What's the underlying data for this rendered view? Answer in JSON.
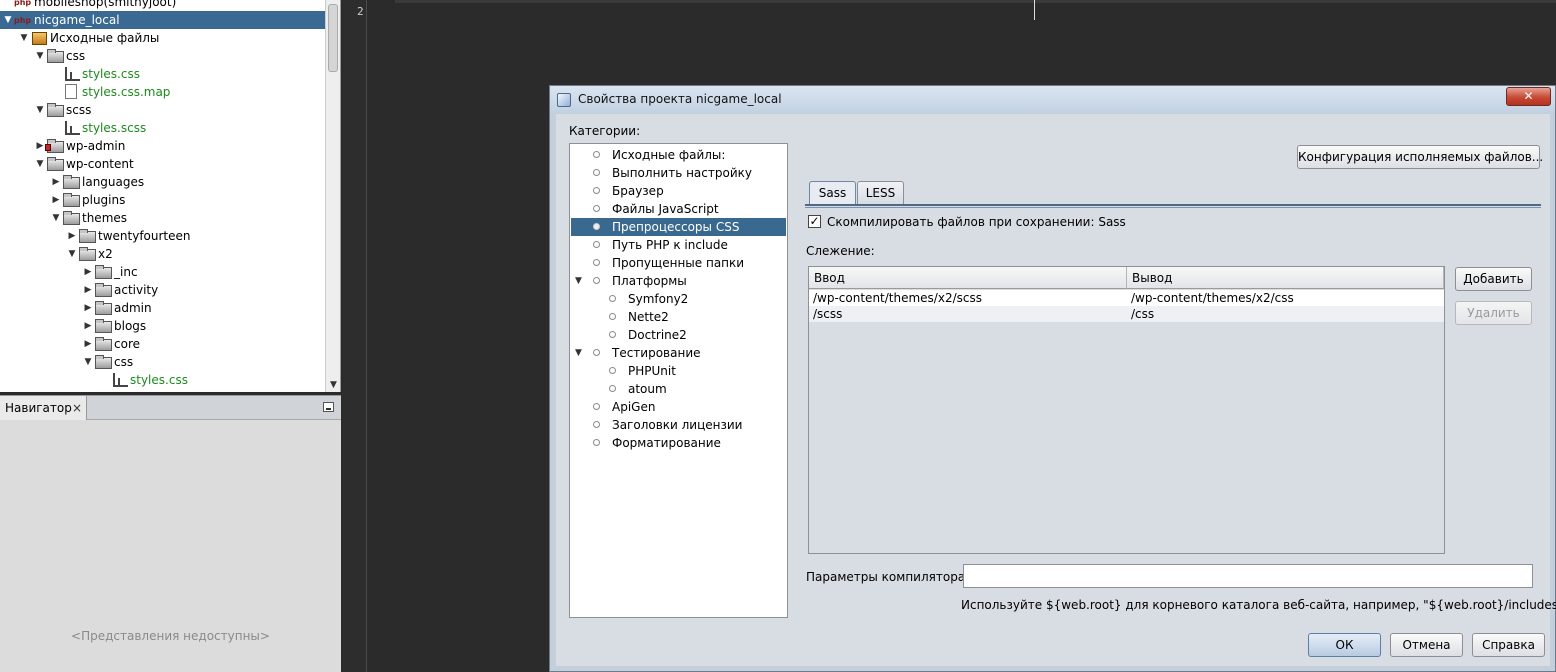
{
  "project_tree": {
    "items": [
      {
        "label": "mobileshop(smithyjoot)",
        "depth": 0,
        "toggle": "",
        "icon": "php-project",
        "green": false
      },
      {
        "label": "nicgame_local",
        "depth": 0,
        "toggle": "▼",
        "icon": "php-project",
        "green": false,
        "selected": true
      },
      {
        "label": "Исходные файлы",
        "depth": 1,
        "toggle": "▼",
        "icon": "source-package",
        "green": false
      },
      {
        "label": "css",
        "depth": 2,
        "toggle": "▼",
        "icon": "folder",
        "green": false
      },
      {
        "label": "styles.css",
        "depth": 3,
        "toggle": "",
        "icon": "css-file",
        "green": true
      },
      {
        "label": "styles.css.map",
        "depth": 3,
        "toggle": "",
        "icon": "document",
        "green": true
      },
      {
        "label": "scss",
        "depth": 2,
        "toggle": "▼",
        "icon": "folder",
        "green": false
      },
      {
        "label": "styles.scss",
        "depth": 3,
        "toggle": "",
        "icon": "css-file",
        "green": true
      },
      {
        "label": "wp-admin",
        "depth": 2,
        "toggle": "▶",
        "icon": "folder-lock",
        "green": false
      },
      {
        "label": "wp-content",
        "depth": 2,
        "toggle": "▼",
        "icon": "folder",
        "green": false
      },
      {
        "label": "languages",
        "depth": 3,
        "toggle": "▶",
        "icon": "folder",
        "green": false
      },
      {
        "label": "plugins",
        "depth": 3,
        "toggle": "▶",
        "icon": "folder",
        "green": false
      },
      {
        "label": "themes",
        "depth": 3,
        "toggle": "▼",
        "icon": "folder",
        "green": false
      },
      {
        "label": "twentyfourteen",
        "depth": 4,
        "toggle": "▶",
        "icon": "folder",
        "green": false
      },
      {
        "label": "x2",
        "depth": 4,
        "toggle": "▼",
        "icon": "folder",
        "green": false
      },
      {
        "label": "_inc",
        "depth": 5,
        "toggle": "▶",
        "icon": "folder",
        "green": false
      },
      {
        "label": "activity",
        "depth": 5,
        "toggle": "▶",
        "icon": "folder",
        "green": false
      },
      {
        "label": "admin",
        "depth": 5,
        "toggle": "▶",
        "icon": "folder",
        "green": false
      },
      {
        "label": "blogs",
        "depth": 5,
        "toggle": "▶",
        "icon": "folder",
        "green": false
      },
      {
        "label": "core",
        "depth": 5,
        "toggle": "▶",
        "icon": "folder",
        "green": false
      },
      {
        "label": "css",
        "depth": 5,
        "toggle": "▼",
        "icon": "folder",
        "green": false
      },
      {
        "label": "styles.css",
        "depth": 6,
        "toggle": "",
        "icon": "css-file",
        "green": true
      }
    ]
  },
  "navigator": {
    "tab_label": "Навигатор",
    "close_glyph": "×",
    "empty_text": "<Представления недоступны>"
  },
  "editor": {
    "line_number": "2"
  },
  "dialog": {
    "title": "Свойства проекта nicgame_local",
    "close_glyph": "✕",
    "categories_label": "Категории:",
    "categories": [
      {
        "label": "Исходные файлы:",
        "level": 0,
        "expander": ""
      },
      {
        "label": "Выполнить настройку",
        "level": 0,
        "expander": ""
      },
      {
        "label": "Браузер",
        "level": 0,
        "expander": ""
      },
      {
        "label": "Файлы JavaScript",
        "level": 0,
        "expander": ""
      },
      {
        "label": "Препроцессоры CSS",
        "level": 0,
        "expander": "",
        "selected": true
      },
      {
        "label": "Путь PHP к include",
        "level": 0,
        "expander": ""
      },
      {
        "label": "Пропущенные папки",
        "level": 0,
        "expander": ""
      },
      {
        "label": "Платформы",
        "level": 0,
        "expander": "▼"
      },
      {
        "label": "Symfony2",
        "level": 1,
        "expander": ""
      },
      {
        "label": "Nette2",
        "level": 1,
        "expander": ""
      },
      {
        "label": "Doctrine2",
        "level": 1,
        "expander": ""
      },
      {
        "label": "Тестирование",
        "level": 0,
        "expander": "▼"
      },
      {
        "label": "PHPUnit",
        "level": 1,
        "expander": ""
      },
      {
        "label": "atoum",
        "level": 1,
        "expander": ""
      },
      {
        "label": "ApiGen",
        "level": 0,
        "expander": ""
      },
      {
        "label": "Заголовки лицензии",
        "level": 0,
        "expander": ""
      },
      {
        "label": "Форматирование",
        "level": 0,
        "expander": ""
      }
    ],
    "configure_executables_button": "Конфигурация исполняемых файлов...",
    "tabs": [
      "Sass",
      "LESS"
    ],
    "compile_on_save": {
      "checked_glyph": "✓",
      "label": "Скомпилировать файлов при сохранении: Sass",
      "checked": true
    },
    "tracking_label": "Слежение:",
    "table": {
      "columns": [
        "Ввод",
        "Вывод"
      ],
      "rows": [
        [
          "/wp-content/themes/x2/scss",
          "/wp-content/themes/x2/css"
        ],
        [
          "/scss",
          "/css"
        ]
      ]
    },
    "add_button": "Добавить",
    "remove_button": "Удалить",
    "compiler_params_label": "Параметры компилятора:",
    "compiler_params_value": "",
    "hint": "Используйте ${web.root} для корневого каталога веб-сайта, например, \"${web.root}/includes\".",
    "ok_button": "ОК",
    "cancel_button": "Отмена",
    "help_button": "Справка"
  }
}
